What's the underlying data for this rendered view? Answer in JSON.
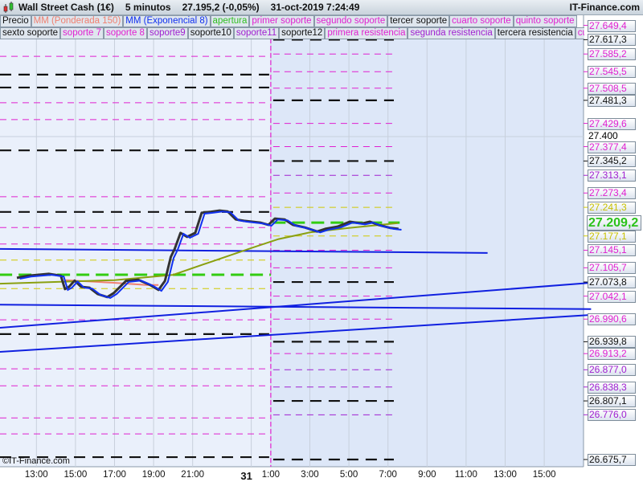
{
  "header": {
    "instrument": "Wall Street Cash (1€)",
    "timeframe": "5 minutos",
    "last": "27.195,2 (-0,05%)",
    "datetime": "31-oct-2019 7:24:49",
    "site": "IT-Finance.com"
  },
  "legend_row1": [
    {
      "label": "Precio",
      "color": "#111111"
    },
    {
      "label": "MM (Ponderada 150)",
      "color": "#f08070"
    },
    {
      "label": "MM (Exponencial 8)",
      "color": "#1030f0"
    },
    {
      "label": "apertura",
      "color": "#30c020"
    },
    {
      "label": "primer soporte",
      "color": "#e020d0"
    },
    {
      "label": "segundo soporte",
      "color": "#e020d0"
    },
    {
      "label": "tercer soporte",
      "color": "#111111"
    },
    {
      "label": "cuarto soporte",
      "color": "#e020d0"
    },
    {
      "label": "quinto soporte",
      "color": "#e020d0"
    }
  ],
  "legend_row2": [
    {
      "label": "sexto soporte",
      "color": "#111111"
    },
    {
      "label": "soporte 7",
      "color": "#e020d0"
    },
    {
      "label": "soporte 8",
      "color": "#e020d0"
    },
    {
      "label": "soporte9",
      "color": "#a020d0"
    },
    {
      "label": "soporte10",
      "color": "#111111"
    },
    {
      "label": "soporte11",
      "color": "#a020d0"
    },
    {
      "label": "soporte12",
      "color": "#111111"
    },
    {
      "label": "primera resistencia",
      "color": "#e020d0"
    },
    {
      "label": "segunda resistencia",
      "color": "#a020d0"
    },
    {
      "label": "tercera resistencia",
      "color": "#111111"
    },
    {
      "label": "cuarta re",
      "color": "#e020d0"
    }
  ],
  "copyright": "©IT-Finance.com",
  "chart_data": {
    "type": "line",
    "title": "Wall Street Cash (1€) 5 minutos",
    "x_unit": "hours since 30-oct 12:00",
    "x_ticks": [
      {
        "h": 1,
        "label": "13:00"
      },
      {
        "h": 3,
        "label": "15:00"
      },
      {
        "h": 5,
        "label": "17:00"
      },
      {
        "h": 7,
        "label": "19:00"
      },
      {
        "h": 9,
        "label": "21:00"
      },
      {
        "h": 12,
        "label": "31",
        "bold": true
      },
      {
        "h": 13,
        "label": "1:00"
      },
      {
        "h": 15,
        "label": "3:00"
      },
      {
        "h": 17,
        "label": "5:00"
      },
      {
        "h": 19,
        "label": "7:00"
      },
      {
        "h": 21,
        "label": "9:00"
      },
      {
        "h": 23,
        "label": "11:00"
      },
      {
        "h": 25,
        "label": "13:00"
      },
      {
        "h": 27,
        "label": "15:00"
      }
    ],
    "day_divider_h": 13,
    "ylim": [
      26660,
      27660
    ],
    "y_tick": {
      "value": 27400,
      "label": "27.400"
    },
    "current_price": {
      "value": 27209.2,
      "label": "27.209,2"
    },
    "price": [
      [
        0,
        27083
      ],
      [
        0.58,
        27088
      ],
      [
        1.63,
        27092
      ],
      [
        2.25,
        27088
      ],
      [
        2.46,
        27058
      ],
      [
        2.67,
        27063
      ],
      [
        2.96,
        27077
      ],
      [
        3.29,
        27063
      ],
      [
        3.71,
        27061
      ],
      [
        4.13,
        27047
      ],
      [
        4.63,
        27040
      ],
      [
        4.96,
        27049
      ],
      [
        5.58,
        27076
      ],
      [
        6.21,
        27079
      ],
      [
        6.83,
        27067
      ],
      [
        7.25,
        27056
      ],
      [
        7.58,
        27076
      ],
      [
        7.88,
        27130
      ],
      [
        8.08,
        27148
      ],
      [
        8.38,
        27184
      ],
      [
        8.71,
        27175
      ],
      [
        9.13,
        27184
      ],
      [
        9.46,
        27229
      ],
      [
        9.88,
        27231
      ],
      [
        10.38,
        27234
      ],
      [
        10.79,
        27232
      ],
      [
        11.21,
        27214
      ],
      [
        11.63,
        27211
      ],
      [
        12.46,
        27207
      ],
      [
        12.88,
        27202
      ],
      [
        13.21,
        27216
      ],
      [
        13.71,
        27214
      ],
      [
        14.13,
        27202
      ],
      [
        14.75,
        27196
      ],
      [
        15.38,
        27187
      ],
      [
        15.79,
        27193
      ],
      [
        16.42,
        27198
      ],
      [
        17.04,
        27209
      ],
      [
        17.67,
        27205
      ],
      [
        18.08,
        27209
      ],
      [
        18.5,
        27202
      ],
      [
        19.13,
        27195
      ],
      [
        19.54,
        27193
      ]
    ],
    "ma_weighted_150": [
      [
        2.46,
        27078
      ],
      [
        4.96,
        27072
      ],
      [
        6.63,
        27067
      ],
      [
        7.25,
        27067
      ]
    ],
    "ma_olive": [
      [
        -0.9,
        27070
      ],
      [
        5,
        27078
      ],
      [
        8,
        27090
      ],
      [
        10,
        27120
      ],
      [
        12,
        27150
      ],
      [
        13.4,
        27170
      ],
      [
        15,
        27185
      ],
      [
        17,
        27195
      ],
      [
        19.5,
        27206
      ]
    ],
    "trend_lines": [
      [
        [
          -0.9,
          27148
        ],
        [
          24.1,
          27139
        ]
      ],
      [
        [
          -0.9,
          27023
        ],
        [
          29.4,
          27013
        ]
      ],
      [
        [
          -0.9,
          26971
        ],
        [
          29.4,
          27072
        ]
      ],
      [
        [
          -0.9,
          26917
        ],
        [
          29.4,
          27000
        ]
      ]
    ],
    "apertura": [
      {
        "from": -0.9,
        "to": 13,
        "value": 27090
      },
      {
        "from": 13.1,
        "to": 19.6,
        "value": 27207
      }
    ],
    "prev_levels": [
      {
        "v": 27539,
        "c": "black"
      },
      {
        "v": 27510,
        "c": "black"
      },
      {
        "v": 27369,
        "c": "black"
      },
      {
        "v": 27231,
        "c": "black"
      },
      {
        "v": 26957,
        "c": "black"
      },
      {
        "v": 26681,
        "c": "black"
      },
      {
        "v": 27580,
        "c": "magenta"
      },
      {
        "v": 27476,
        "c": "magenta"
      },
      {
        "v": 27438,
        "c": "magenta"
      },
      {
        "v": 27265,
        "c": "magenta"
      },
      {
        "v": 27196,
        "c": "magenta"
      },
      {
        "v": 27159,
        "c": "magenta"
      },
      {
        "v": 26989,
        "c": "magenta"
      },
      {
        "v": 26879,
        "c": "magenta"
      },
      {
        "v": 26841,
        "c": "magenta"
      },
      {
        "v": 26769,
        "c": "magenta"
      },
      {
        "v": 26733,
        "c": "magenta"
      },
      {
        "v": 27123,
        "c": "yellow"
      },
      {
        "v": 27059,
        "c": "yellow"
      }
    ],
    "levels": [
      {
        "v": 27649.4,
        "label": "27.649,4",
        "c": "magenta"
      },
      {
        "v": 27617.3,
        "label": "27.617,3",
        "c": "black"
      },
      {
        "v": 27585.2,
        "label": "27.585,2",
        "c": "magenta"
      },
      {
        "v": 27545.5,
        "label": "27.545,5",
        "c": "magenta"
      },
      {
        "v": 27508.5,
        "label": "27.508,5",
        "c": "magenta"
      },
      {
        "v": 27481.3,
        "label": "27.481,3",
        "c": "black"
      },
      {
        "v": 27429.6,
        "label": "27.429,6",
        "c": "magenta"
      },
      {
        "v": 27377.4,
        "label": "27.377,4",
        "c": "magenta"
      },
      {
        "v": 27345.2,
        "label": "27.345,2",
        "c": "black"
      },
      {
        "v": 27313.1,
        "label": "27.313,1",
        "c": "purple"
      },
      {
        "v": 27273.4,
        "label": "27.273,4",
        "c": "magenta"
      },
      {
        "v": 27241.3,
        "label": "27.241,3",
        "c": "yellow"
      },
      {
        "v": 27177.1,
        "label": "27.177,1",
        "c": "yellow"
      },
      {
        "v": 27145.1,
        "label": "27.145,1",
        "c": "magenta"
      },
      {
        "v": 27105.7,
        "label": "27.105,7",
        "c": "magenta"
      },
      {
        "v": 27073.8,
        "label": "27.073,8",
        "c": "black"
      },
      {
        "v": 27042.1,
        "label": "27.042,1",
        "c": "magenta"
      },
      {
        "v": 26990.6,
        "label": "26.990,6",
        "c": "magenta"
      },
      {
        "v": 26939.8,
        "label": "26.939,8",
        "c": "black"
      },
      {
        "v": 26913.2,
        "label": "26.913,2",
        "c": "magenta"
      },
      {
        "v": 26877.0,
        "label": "26.877,0",
        "c": "purple"
      },
      {
        "v": 26838.3,
        "label": "26.838,3",
        "c": "purple"
      },
      {
        "v": 26807.1,
        "label": "26.807,1",
        "c": "black"
      },
      {
        "v": 26776.0,
        "label": "26.776,0",
        "c": "purple"
      },
      {
        "v": 26675.7,
        "label": "26.675,7",
        "c": "black"
      }
    ],
    "colors": {
      "black": "#111111",
      "magenta": "#e020d0",
      "purple": "#a020d0",
      "yellow": "#d0c800",
      "apertura": "#33cc11",
      "ema": "#1030f0",
      "olive": "#8aa010",
      "weighted": "#f08070",
      "trend": "#1020e0"
    }
  }
}
